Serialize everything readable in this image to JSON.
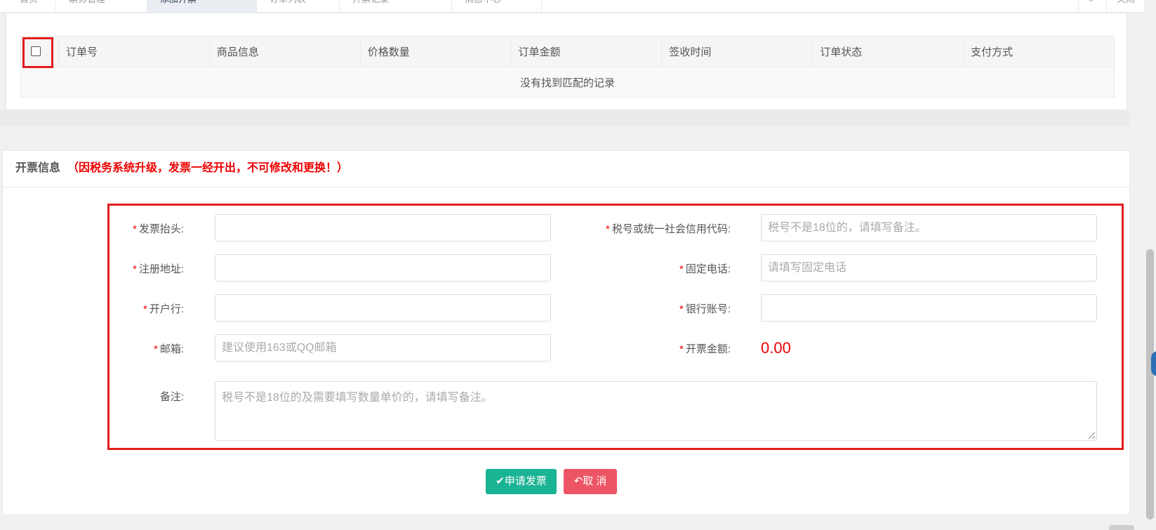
{
  "tabs": [
    "首页",
    "票务管理",
    "添加开票",
    "订单列表",
    "开票记录",
    "消息中心"
  ],
  "tab_right": "关闭",
  "table": {
    "columns": [
      "订单号",
      "商品信息",
      "价格数量",
      "订单金额",
      "签收时间",
      "订单状态",
      "支付方式"
    ],
    "empty_text": "没有找到匹配的记录"
  },
  "invoice": {
    "title": "开票信息",
    "notice": "（因税务系统升级，发票一经开出，不可修改和更换！）",
    "fields": {
      "title_label": "发票抬头:",
      "tax_label": "税号或统一社会信用代码:",
      "tax_placeholder": "税号不是18位的，请填写备注。",
      "address_label": "注册地址:",
      "phone_label": "固定电话:",
      "phone_placeholder": "请填写固定电话",
      "bank_label": "开户行:",
      "account_label": "银行账号:",
      "email_label": "邮箱:",
      "email_placeholder": "建议使用163或QQ邮箱",
      "amount_label": "开票金额:",
      "amount_value": "0.00",
      "remark_label": "备注:",
      "remark_placeholder": "税号不是18位的及需要填写数量单价的，请填写备注。"
    },
    "buttons": {
      "submit": "✔申请发票",
      "cancel": "↶取 消"
    }
  },
  "colors": {
    "accent_green": "#1ab394",
    "cancel_red": "#ed5565",
    "highlight_red": "#e31d1d"
  }
}
